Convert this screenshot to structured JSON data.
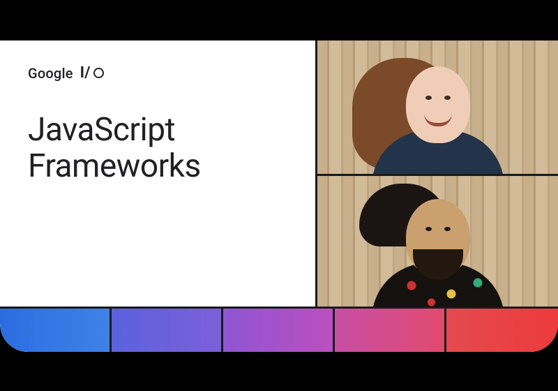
{
  "brand": {
    "name": "Google",
    "event_mark": "I/O"
  },
  "title_line1": "JavaScript",
  "title_line2": "Frameworks",
  "speakers": [
    {
      "position": "top"
    },
    {
      "position": "bottom"
    }
  ],
  "rainbow_colors": [
    "#2b6de0",
    "#5a62dc",
    "#8f55d4",
    "#c74ea6",
    "#e44a4f"
  ]
}
